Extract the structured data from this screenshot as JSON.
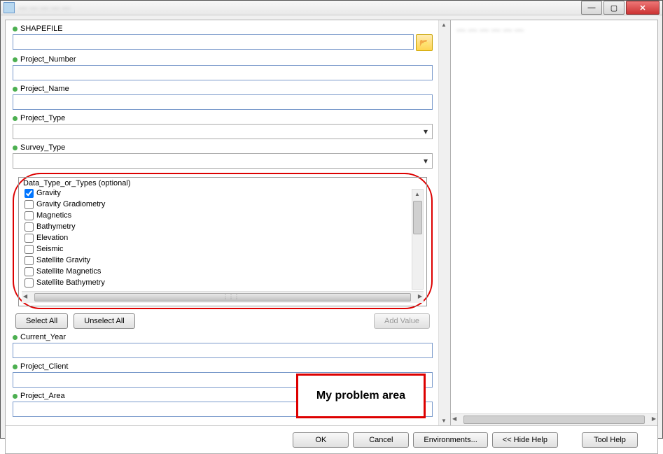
{
  "titlebar": {
    "title": "— — — — —"
  },
  "win_controls": {
    "minimize": "—",
    "maximize": "▢",
    "close": "✕"
  },
  "fields": {
    "shapefile": {
      "label": "SHAPEFILE",
      "value": ""
    },
    "project_number": {
      "label": "Project_Number",
      "value": ""
    },
    "project_name": {
      "label": "Project_Name",
      "value": ""
    },
    "project_type": {
      "label": "Project_Type",
      "value": ""
    },
    "survey_type": {
      "label": "Survey_Type",
      "value": ""
    },
    "current_year": {
      "label": "Current_Year",
      "value": ""
    },
    "project_client": {
      "label": "Project_Client",
      "value": ""
    },
    "project_area": {
      "label": "Project_Area",
      "value": ""
    }
  },
  "data_types": {
    "label": "Data_Type_or_Types (optional)",
    "items": [
      {
        "label": "Gravity",
        "checked": true
      },
      {
        "label": "Gravity Gradiometry",
        "checked": false
      },
      {
        "label": "Magnetics",
        "checked": false
      },
      {
        "label": "Bathymetry",
        "checked": false
      },
      {
        "label": "Elevation",
        "checked": false
      },
      {
        "label": "Seismic",
        "checked": false
      },
      {
        "label": "Satellite Gravity",
        "checked": false
      },
      {
        "label": "Satellite Magnetics",
        "checked": false
      },
      {
        "label": "Satellite Bathymetry",
        "checked": false
      }
    ]
  },
  "buttons": {
    "select_all": "Select All",
    "unselect_all": "Unselect All",
    "add_value": "Add Value",
    "ok": "OK",
    "cancel": "Cancel",
    "environments": "Environments...",
    "hide_help": "<< Hide Help",
    "tool_help": "Tool Help"
  },
  "help": {
    "heading": "— — — — — —"
  },
  "icons": {
    "browse": "📂",
    "hscroll_grip": "⋮⋮⋮"
  },
  "callout": "My problem area"
}
